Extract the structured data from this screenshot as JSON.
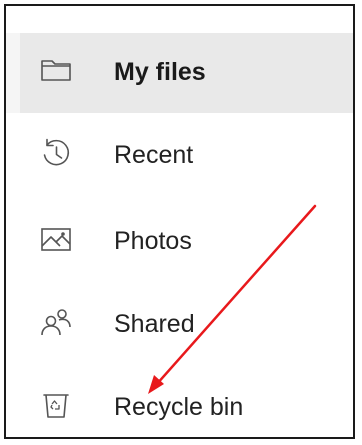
{
  "nav": {
    "items": [
      {
        "label": "My files",
        "icon": "folder-icon",
        "active": true
      },
      {
        "label": "Recent",
        "icon": "history-icon",
        "active": false
      },
      {
        "label": "Photos",
        "icon": "image-icon",
        "active": false
      },
      {
        "label": "Shared",
        "icon": "people-icon",
        "active": false
      },
      {
        "label": "Recycle bin",
        "icon": "recycle-bin-icon",
        "active": false
      }
    ]
  },
  "colors": {
    "active_background": "#e9e9e9",
    "text": "#222222",
    "icon_stroke": "#555555",
    "annotation_arrow": "#e8191c"
  }
}
